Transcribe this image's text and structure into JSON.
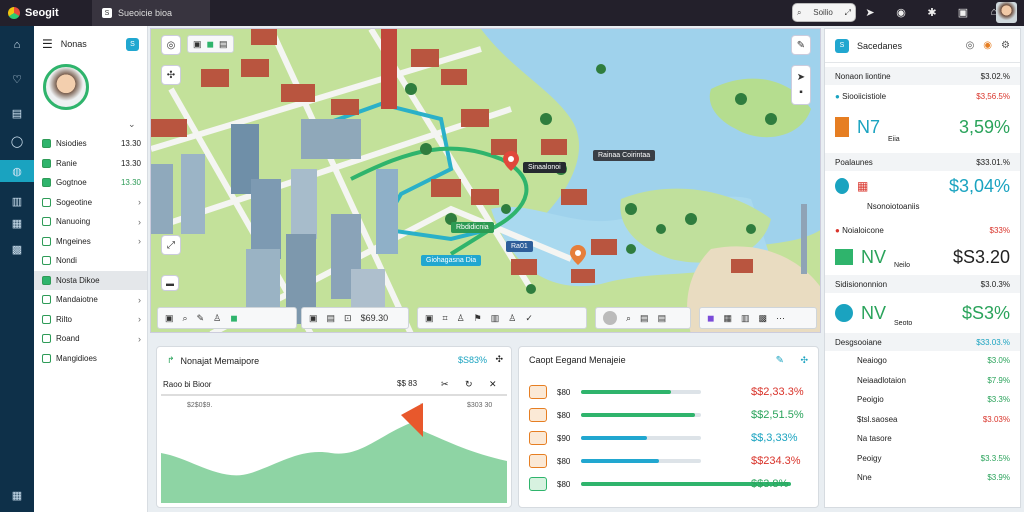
{
  "topbar": {
    "brand": "Seogit",
    "app_tab": "Sueoicie bioa",
    "search_label": "Soilio"
  },
  "sidebar": {
    "title": "Nonas",
    "items": [
      {
        "label": "Nsiodies",
        "value": "13.30",
        "kind": "value"
      },
      {
        "label": "Ranie",
        "value": "13.30",
        "kind": "value"
      },
      {
        "label": "Gogtnoe",
        "value": "13.30",
        "kind": "value-green"
      },
      {
        "label": "Sogeotine",
        "kind": "arrow"
      },
      {
        "label": "Nanuoing",
        "kind": "arrow"
      },
      {
        "label": "Mngeines",
        "kind": "arrow"
      },
      {
        "label": "Nondi",
        "kind": "plain"
      },
      {
        "label": "Nosta Dikoe",
        "kind": "selected"
      },
      {
        "label": "Mandaiotne",
        "kind": "arrow"
      },
      {
        "label": "Rilto",
        "kind": "arrow"
      },
      {
        "label": "Roand",
        "kind": "arrow"
      },
      {
        "label": "Mangidioes",
        "kind": "plain"
      }
    ]
  },
  "map": {
    "tooltips": [
      "Rainaa Coirintaa",
      "Sinaalonoi",
      "Rbdidicnia",
      "Ra01",
      "Giohagasna Dia"
    ],
    "toolbar_value": "$69.30"
  },
  "right_panel": {
    "title": "Sacedanes",
    "sections": [
      {
        "header": "Nonaon liontine",
        "header_value": "$3.02.%"
      },
      {
        "label": "Siooiicistiole",
        "value": "$3,56.5%"
      },
      {
        "big_label": "N7",
        "sub": "Eiia",
        "big_value": "3,59%",
        "style": "grn"
      },
      {
        "header": "Poalaunes",
        "header_value": "$33.01.%"
      },
      {
        "label": "Nsonoiotoaniis",
        "big_value": "$3,04%",
        "style": "tl"
      },
      {
        "label": "Noialoicone",
        "value": "$33%"
      },
      {
        "big_label": "NV",
        "sub": "Neilo",
        "big_value": "$S3.20",
        "style": "dark"
      },
      {
        "header": "Sidisiononnion",
        "header_value": "$3.0.3%"
      },
      {
        "big_label": "NV",
        "sub": "Seoto",
        "big_value": "$S3%",
        "style": "grn"
      },
      {
        "header": "Desgsooiane",
        "header_value": "$33.03.%"
      }
    ],
    "list": [
      {
        "label": "Neaiogo",
        "value": "$3.0%"
      },
      {
        "label": "Neiaadlotaion",
        "value": "$7.9%"
      },
      {
        "label": "Peoigio",
        "value": "$3.3%"
      },
      {
        "label": "$tsl.saosea",
        "value": "$3.03%"
      },
      {
        "label": "Na tasore",
        "value": ""
      },
      {
        "label": "Peoigy",
        "value": "$3.3.5%"
      },
      {
        "label": "Nne",
        "value": "$3.9%"
      }
    ]
  },
  "bottom_left": {
    "title": "Nonajat Memaipore",
    "value": "$S83%",
    "sub": "Raoo bi Bioor",
    "marker_label": "$$ 83",
    "left_label": "$2$0$9.",
    "right_label": "$303 30"
  },
  "bottom_mid": {
    "title": "Caopt Eegand Menajeie",
    "rows": [
      {
        "name": "$80",
        "value": "$$2,33.3%",
        "pct": 0.75,
        "color": "#2fb46c",
        "valcolor": "red"
      },
      {
        "name": "$80",
        "value": "$$2,51.5%",
        "pct": 0.95,
        "color": "#2fb46c",
        "valcolor": "grn"
      },
      {
        "name": "$90",
        "value": "$$,3,33%",
        "pct": 0.55,
        "color": "#21a7d0",
        "valcolor": "tl"
      },
      {
        "name": "$80",
        "value": "$$234.3%",
        "pct": 0.65,
        "color": "#21a7d0",
        "valcolor": "red"
      },
      {
        "name": "$80",
        "value": "$$3.8%",
        "pct": 1.0,
        "color": "#2fb46c",
        "valcolor": "grn"
      }
    ]
  },
  "colors": {
    "accent": "#1aa3c0",
    "green": "#2fb46c",
    "red": "#d9342b",
    "dark": "#23202b"
  }
}
